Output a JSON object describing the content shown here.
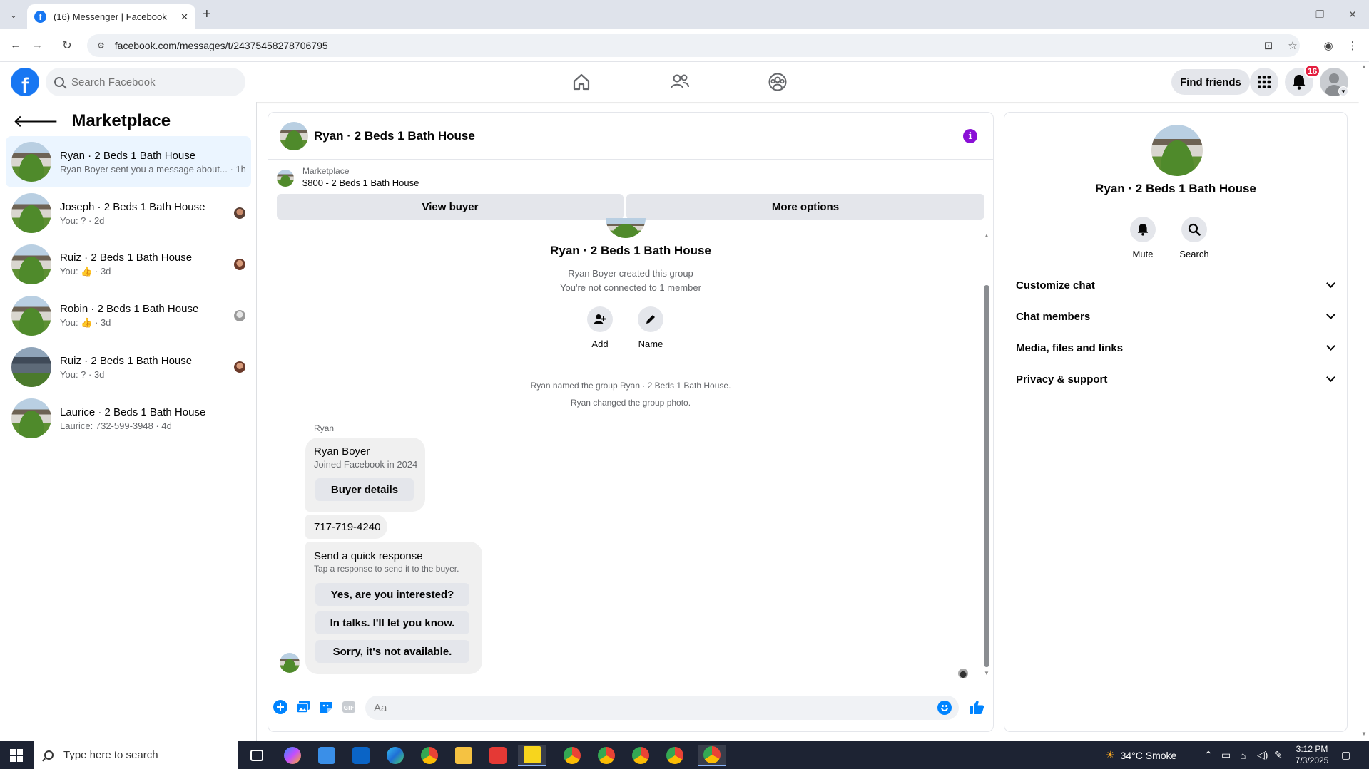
{
  "browser": {
    "tab_title": "(16) Messenger | Facebook",
    "new_tab": "+",
    "url": "facebook.com/messages/t/24375458278706795"
  },
  "fb_nav": {
    "search_placeholder": "Search Facebook",
    "find_friends": "Find friends",
    "notification_count": "16"
  },
  "sidebar": {
    "title": "Marketplace",
    "conversations": [
      {
        "name": "Ryan · 2 Beds 1 Bath House",
        "preview": "Ryan Boyer sent you a message about... · 1h",
        "active": true
      },
      {
        "name": "Joseph · 2 Beds 1 Bath House",
        "preview": "You: ? · 2d"
      },
      {
        "name": "Ruiz · 2 Beds 1 Bath House",
        "preview_prefix": "You:",
        "preview_suffix": "· 3d"
      },
      {
        "name": "Robin · 2 Beds 1 Bath House",
        "preview_prefix": "You:",
        "preview_suffix": "· 3d"
      },
      {
        "name": "Ruiz · 2 Beds 1 Bath House",
        "preview": "You: ? · 3d"
      },
      {
        "name": "Laurice · 2 Beds 1 Bath House",
        "preview": "Laurice: 732-599-3948 · 4d"
      }
    ]
  },
  "chat": {
    "title": "Ryan · 2 Beds 1 Bath House",
    "marketplace_label": "Marketplace",
    "listing": "$800 - 2 Beds 1 Bath House",
    "view_buyer": "View buyer",
    "more_options": "More options",
    "group_title": "Ryan · 2 Beds 1 Bath House",
    "created_by": "Ryan Boyer created this group",
    "not_connected": "You're not connected to 1 member",
    "add_label": "Add",
    "name_label": "Name",
    "sys_named": "Ryan named the group Ryan · 2 Beds 1 Bath House.",
    "sys_photo": "Ryan changed the group photo.",
    "sender": "Ryan",
    "buyer_name": "Ryan Boyer",
    "buyer_joined": "Joined Facebook in 2024",
    "buyer_details": "Buyer details",
    "phone": "717-719-4240",
    "quick_title": "Send a quick response",
    "quick_sub": "Tap a response to send it to the buyer.",
    "quick_responses": [
      "Yes, are you interested?",
      "In talks. I'll let you know.",
      "Sorry, it's not available."
    ],
    "composer_placeholder": "Aa"
  },
  "info_panel": {
    "title": "Ryan · 2 Beds 1 Bath House",
    "mute": "Mute",
    "search": "Search",
    "sections": [
      "Customize chat",
      "Chat members",
      "Media, files and links",
      "Privacy & support"
    ]
  },
  "taskbar": {
    "search_placeholder": "Type here to search",
    "weather": "34°C  Smoke",
    "time": "3:12 PM",
    "date": "7/3/2025"
  },
  "colors": {
    "fb_blue": "#1877f2",
    "messenger_blue": "#0084ff",
    "badge_red": "#e41e3f",
    "info_purple": "#8a0fd6",
    "active_row": "#ebf5ff"
  }
}
